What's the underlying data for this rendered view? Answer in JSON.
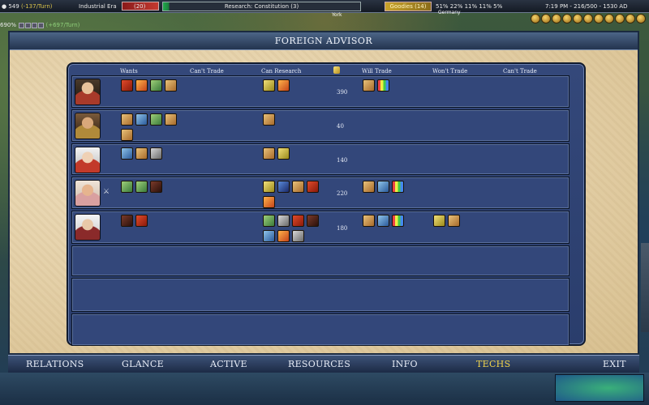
{
  "top_bar": {
    "gold": "549",
    "gold_rate": "(-137/Turn)",
    "era": "Industrial Era",
    "great_person": "(20)",
    "research": "Research: Constitution (3)",
    "culture": "Goodies (14)",
    "sliders": "51%  22%  11%  11%  5%",
    "clock": "7:19 PM - 216/500 - 1530 AD"
  },
  "second_row": {
    "value": "690%",
    "rate": "(+697/Turn)"
  },
  "map_labels": {
    "city1": "York",
    "city2": "Germany"
  },
  "window": {
    "title": "FOREIGN ADVISOR"
  },
  "columns": {
    "wants": "Wants",
    "cant_trade_1": "Can't Trade",
    "can_research": "Can Research",
    "will_trade": "Will Trade",
    "wont_trade": "Won't Trade",
    "cant_trade_2": "Can't Trade"
  },
  "rows": [
    {
      "leader": "leader-1",
      "gold": "390",
      "wants": [
        "t-red",
        "t-orange",
        "t-green",
        "t-tan"
      ],
      "can_research": [
        "t-gold",
        "t-orange"
      ],
      "will_trade": [
        "t-tan",
        "t-rainbow"
      ],
      "wont_trade": []
    },
    {
      "leader": "leader-2",
      "gold": "40",
      "wants": [
        "t-tan",
        "t-blue",
        "t-green",
        "t-tan",
        "t-tan"
      ],
      "can_research": [
        "t-tan"
      ],
      "will_trade": [],
      "wont_trade": []
    },
    {
      "leader": "leader-3",
      "gold": "140",
      "wants": [
        "t-blue",
        "t-tan",
        "t-gray"
      ],
      "can_research": [
        "t-tan",
        "t-gold"
      ],
      "will_trade": [],
      "wont_trade": []
    },
    {
      "leader": "leader-4",
      "gold": "220",
      "wants": [
        "t-green",
        "t-green",
        "t-dark"
      ],
      "can_research": [
        "t-gold",
        "t-navy",
        "t-tan",
        "t-red",
        "t-orange"
      ],
      "will_trade": [
        "t-tan",
        "t-blue",
        "t-rainbow"
      ],
      "wont_trade": []
    },
    {
      "leader": "leader-5",
      "gold": "180",
      "wants": [
        "t-dark",
        "t-red"
      ],
      "can_research": [
        "t-green",
        "t-gray",
        "t-red",
        "t-dark",
        "t-blue",
        "t-orange",
        "t-gray"
      ],
      "will_trade": [
        "t-tan",
        "t-blue",
        "t-rainbow"
      ],
      "wont_trade": [
        "t-gold",
        "t-tan"
      ]
    }
  ],
  "tabs": [
    "RELATIONS",
    "GLANCE",
    "ACTIVE",
    "RESOURCES",
    "INFO",
    "TECHS",
    "EXIT"
  ],
  "active_tab": "TECHS",
  "colors": {
    "active_tab": "#f0d34a",
    "panel": "#34487a",
    "parchment": "#e8d7b3"
  }
}
